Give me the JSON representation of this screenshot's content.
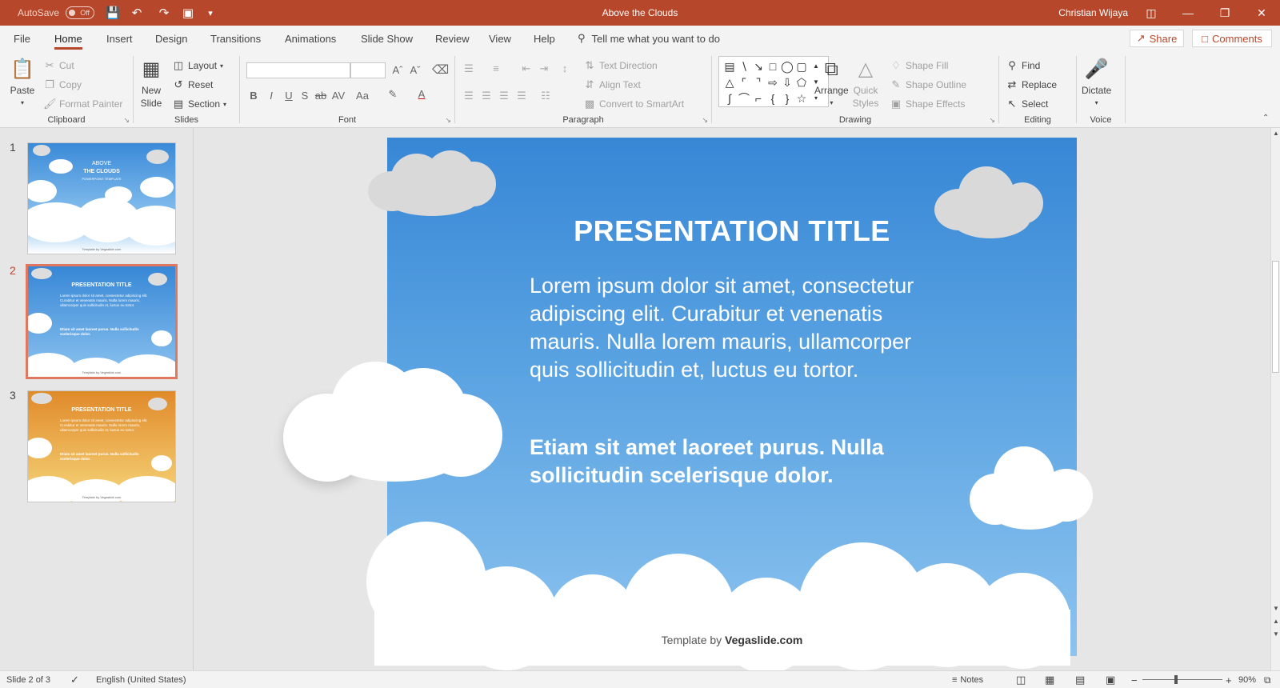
{
  "titlebar": {
    "autosave_label": "AutoSave",
    "autosave_state": "Off",
    "document_title": "Above the Clouds",
    "user_name": "Christian Wijaya"
  },
  "menu": {
    "tabs": [
      "File",
      "Home",
      "Insert",
      "Design",
      "Transitions",
      "Animations",
      "Slide Show",
      "Review",
      "View",
      "Help"
    ],
    "active_tab": "Home",
    "tell_me": "Tell me what you want to do",
    "share": "Share",
    "comments": "Comments"
  },
  "ribbon": {
    "clipboard": {
      "label": "Clipboard",
      "paste": "Paste",
      "cut": "Cut",
      "copy": "Copy",
      "format_painter": "Format Painter"
    },
    "slides": {
      "label": "Slides",
      "new_slide_1": "New",
      "new_slide_2": "Slide",
      "layout": "Layout",
      "reset": "Reset",
      "section": "Section"
    },
    "font": {
      "label": "Font"
    },
    "paragraph": {
      "label": "Paragraph",
      "text_direction": "Text Direction",
      "align_text": "Align Text",
      "convert_smartart": "Convert to SmartArt"
    },
    "drawing": {
      "label": "Drawing",
      "arrange": "Arrange",
      "quick_styles_1": "Quick",
      "quick_styles_2": "Styles",
      "shape_fill": "Shape Fill",
      "shape_outline": "Shape Outline",
      "shape_effects": "Shape Effects"
    },
    "editing": {
      "label": "Editing",
      "find": "Find",
      "replace": "Replace",
      "select": "Select"
    },
    "voice": {
      "label": "Voice",
      "dictate": "Dictate"
    }
  },
  "thumbnails": [
    {
      "number": "1",
      "title_1": "ABOVE",
      "title_2": "THE CLOUDS",
      "subtitle": "POWERPOINT TEMPLATE",
      "footer": "Template by Vegaslide.com",
      "theme": "blue"
    },
    {
      "number": "2",
      "title": "PRESENTATION TITLE",
      "body": "Lorem ipsum dolor sit amet, consectetur adipiscing elit. Curabitur et venenatis mauris. Nulla lorem mauris, ullamcorper quis sollicitudin et, luctus eu tortor.",
      "bold": "Etiam sit amet laoreet purus. Nulla sollicitudin scelerisque dolor.",
      "footer": "Template by Vegaslide.com",
      "theme": "blue",
      "selected": true
    },
    {
      "number": "3",
      "title": "PRESENTATION TITLE",
      "body": "Lorem ipsum dolor sit amet, consectetur adipiscing elit. Curabitur et venenatis mauris. Nulla lorem mauris, ullamcorper quis sollicitudin et, luctus eu tortor.",
      "bold": "Etiam sit amet laoreet purus. Nulla sollicitudin scelerisque dolor.",
      "footer": "Template by Vegaslide.com",
      "theme": "orange"
    }
  ],
  "slide": {
    "title": "PRESENTATION TITLE",
    "body": "Lorem ipsum dolor sit amet, consectetur adipiscing elit. Curabitur et venenatis mauris. Nulla lorem mauris, ullamcorper quis sollicitudin et, luctus eu tortor.",
    "bold": "Etiam sit amet laoreet purus. Nulla sollicitudin scelerisque dolor.",
    "footer_prefix": "Template by ",
    "footer_brand": "Vegaslide.com"
  },
  "status": {
    "slide_counter": "Slide 2 of 3",
    "language": "English (United States)",
    "notes": "Notes",
    "zoom": "90%"
  },
  "colors": {
    "accent": "#b7472a",
    "sky_top": "#3787d6",
    "sky_bottom": "#8cc3ef",
    "sunset_top": "#e08a2a",
    "sunset_bottom": "#f6d57a"
  }
}
